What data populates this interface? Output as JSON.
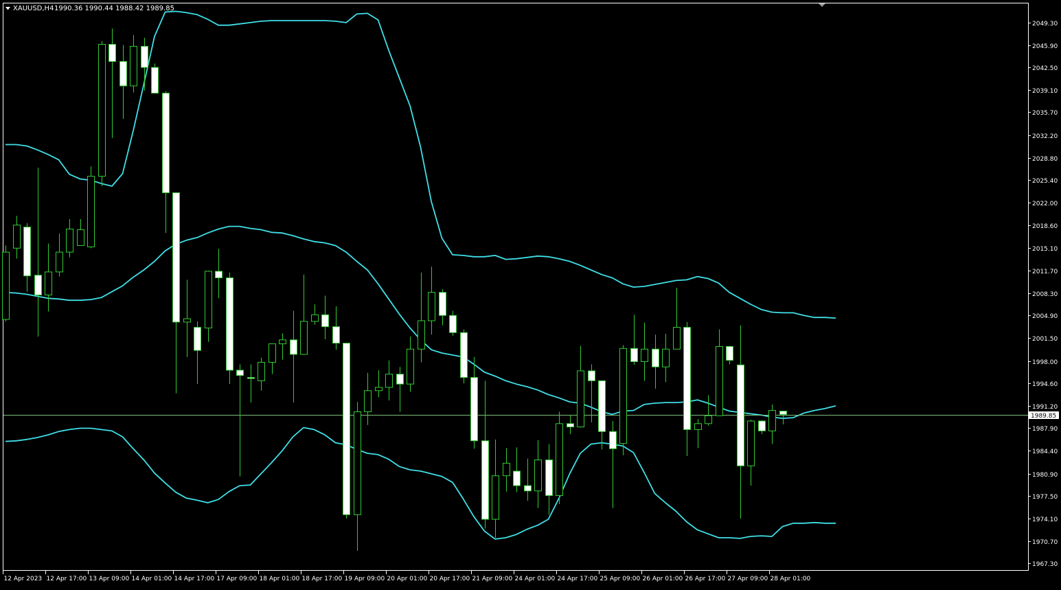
{
  "header": {
    "symbol": "XAUUSD,H4",
    "ohlc": "1990.36 1990.44 1988.42 1989.85"
  },
  "colors": {
    "background": "#000000",
    "frame": "#ffffff",
    "bull_body": "#000000",
    "bear_body": "#ffffff",
    "wick": "#33cc33",
    "bands": "#40e0e8",
    "bid_line": "#7fbf7f",
    "current_price_bg": "#ffffff",
    "current_price_text": "#000000"
  },
  "current_price": {
    "value": 1989.85,
    "label": "1989.85"
  },
  "chart_data": {
    "type": "candlestick",
    "symbol": "XAUUSD",
    "timeframe": "H4",
    "grid": false,
    "ylim": [
      1966.3,
      2052.2
    ],
    "y_ticks": [
      {
        "value": 2049.3,
        "label": "2049.30"
      },
      {
        "value": 2045.9,
        "label": "2045.90"
      },
      {
        "value": 2042.5,
        "label": "2042.50"
      },
      {
        "value": 2039.1,
        "label": "2039.10"
      },
      {
        "value": 2035.7,
        "label": "2035.70"
      },
      {
        "value": 2032.2,
        "label": "2032.20"
      },
      {
        "value": 2028.8,
        "label": "2028.80"
      },
      {
        "value": 2025.4,
        "label": "2025.40"
      },
      {
        "value": 2022.0,
        "label": "2022.00"
      },
      {
        "value": 2018.6,
        "label": "2018.60"
      },
      {
        "value": 2015.1,
        "label": "2015.10"
      },
      {
        "value": 2011.7,
        "label": "2011.70"
      },
      {
        "value": 2008.3,
        "label": "2008.30"
      },
      {
        "value": 2004.9,
        "label": "2004.90"
      },
      {
        "value": 2001.5,
        "label": "2001.50"
      },
      {
        "value": 1998.0,
        "label": "1998.00"
      },
      {
        "value": 1994.6,
        "label": "1994.60"
      },
      {
        "value": 1991.2,
        "label": "1991.20"
      },
      {
        "value": 1987.9,
        "label": "1987.90"
      },
      {
        "value": 1984.4,
        "label": "1984.40"
      },
      {
        "value": 1980.9,
        "label": "1980.90"
      },
      {
        "value": 1977.5,
        "label": "1977.50"
      },
      {
        "value": 1974.1,
        "label": "1974.10"
      },
      {
        "value": 1970.7,
        "label": "1970.70"
      },
      {
        "value": 1967.3,
        "label": "1967.30"
      }
    ],
    "x_ticks": [
      {
        "index": 0,
        "label": "12 Apr 2023"
      },
      {
        "index": 4,
        "label": "12 Apr 17:00"
      },
      {
        "index": 8,
        "label": "13 Apr 09:00"
      },
      {
        "index": 12,
        "label": "14 Apr 01:00"
      },
      {
        "index": 16,
        "label": "14 Apr 17:00"
      },
      {
        "index": 20,
        "label": "17 Apr 09:00"
      },
      {
        "index": 24,
        "label": "18 Apr 01:00"
      },
      {
        "index": 28,
        "label": "18 Apr 17:00"
      },
      {
        "index": 32,
        "label": "19 Apr 09:00"
      },
      {
        "index": 36,
        "label": "20 Apr 01:00"
      },
      {
        "index": 40,
        "label": "20 Apr 17:00"
      },
      {
        "index": 44,
        "label": "21 Apr 09:00"
      },
      {
        "index": 48,
        "label": "24 Apr 01:00"
      },
      {
        "index": 52,
        "label": "24 Apr 17:00"
      },
      {
        "index": 56,
        "label": "25 Apr 09:00"
      },
      {
        "index": 60,
        "label": "26 Apr 01:00"
      },
      {
        "index": 64,
        "label": "26 Apr 17:00"
      },
      {
        "index": 68,
        "label": "27 Apr 09:00"
      },
      {
        "index": 72,
        "label": "28 Apr 01:00"
      }
    ],
    "candles": [
      {
        "o": 2004.3,
        "h": 2015.5,
        "l": 2004.0,
        "c": 2014.5
      },
      {
        "o": 2015.1,
        "h": 2020.0,
        "l": 2013.5,
        "c": 2018.6
      },
      {
        "o": 2018.3,
        "h": 2018.9,
        "l": 2008.5,
        "c": 2010.9
      },
      {
        "o": 2011.0,
        "h": 2027.3,
        "l": 2001.7,
        "c": 2008.0
      },
      {
        "o": 2008.0,
        "h": 2015.8,
        "l": 2005.5,
        "c": 2011.5
      },
      {
        "o": 2011.5,
        "h": 2017.3,
        "l": 2010.8,
        "c": 2014.5
      },
      {
        "o": 2014.5,
        "h": 2019.5,
        "l": 2013.7,
        "c": 2018.0
      },
      {
        "o": 2015.5,
        "h": 2019.5,
        "l": 2015.5,
        "c": 2017.9
      },
      {
        "o": 2015.3,
        "h": 2027.5,
        "l": 2015.1,
        "c": 2026.0
      },
      {
        "o": 2026.0,
        "h": 2046.5,
        "l": 2024.5,
        "c": 2046.0
      },
      {
        "o": 2046.0,
        "h": 2048.4,
        "l": 2031.8,
        "c": 2043.4
      },
      {
        "o": 2043.4,
        "h": 2045.9,
        "l": 2034.7,
        "c": 2039.7
      },
      {
        "o": 2039.7,
        "h": 2047.4,
        "l": 2038.7,
        "c": 2045.7
      },
      {
        "o": 2045.7,
        "h": 2047.0,
        "l": 2039.0,
        "c": 2042.5
      },
      {
        "o": 2042.5,
        "h": 2043.1,
        "l": 2038.6,
        "c": 2038.6
      },
      {
        "o": 2038.6,
        "h": 2038.9,
        "l": 2017.4,
        "c": 2023.5
      },
      {
        "o": 2023.5,
        "h": 2023.5,
        "l": 1993.1,
        "c": 2003.9
      },
      {
        "o": 2003.9,
        "h": 2010.3,
        "l": 1998.6,
        "c": 2004.4
      },
      {
        "o": 2003.1,
        "h": 2004.0,
        "l": 1994.5,
        "c": 1999.6
      },
      {
        "o": 2003.0,
        "h": 2011.7,
        "l": 2000.9,
        "c": 2011.6
      },
      {
        "o": 2011.6,
        "h": 2015.0,
        "l": 2007.5,
        "c": 2010.6
      },
      {
        "o": 2010.6,
        "h": 2011.4,
        "l": 1994.5,
        "c": 1996.6
      },
      {
        "o": 1996.6,
        "h": 1997.5,
        "l": 1980.5,
        "c": 1995.8
      },
      {
        "o": 1995.5,
        "h": 1997.5,
        "l": 1991.7,
        "c": 1995.4
      },
      {
        "o": 1995.0,
        "h": 1998.5,
        "l": 1993.5,
        "c": 1997.8
      },
      {
        "o": 1997.8,
        "h": 2000.5,
        "l": 1996.0,
        "c": 2000.6
      },
      {
        "o": 2000.6,
        "h": 2002.2,
        "l": 1998.2,
        "c": 2001.2
      },
      {
        "o": 2001.2,
        "h": 2005.6,
        "l": 1991.7,
        "c": 1999.0
      },
      {
        "o": 1999.0,
        "h": 2011.1,
        "l": 1998.9,
        "c": 2004.0
      },
      {
        "o": 2004.0,
        "h": 2006.6,
        "l": 2003.5,
        "c": 2005.0
      },
      {
        "o": 2005.0,
        "h": 2007.9,
        "l": 2001.3,
        "c": 2003.2
      },
      {
        "o": 2003.2,
        "h": 2006.3,
        "l": 1999.7,
        "c": 2000.7
      },
      {
        "o": 2000.7,
        "h": 2000.7,
        "l": 1974.1,
        "c": 1974.7
      },
      {
        "o": 1974.7,
        "h": 1991.8,
        "l": 1969.2,
        "c": 1990.3
      },
      {
        "o": 1990.3,
        "h": 1996.2,
        "l": 1988.3,
        "c": 1993.5
      },
      {
        "o": 1993.5,
        "h": 1996.6,
        "l": 1992.5,
        "c": 1994.0
      },
      {
        "o": 1994.0,
        "h": 1998.1,
        "l": 1992.0,
        "c": 1996.0
      },
      {
        "o": 1996.0,
        "h": 1997.1,
        "l": 1990.3,
        "c": 1994.5
      },
      {
        "o": 1994.5,
        "h": 2001.7,
        "l": 1993.3,
        "c": 1999.8
      },
      {
        "o": 1999.8,
        "h": 2011.4,
        "l": 1997.8,
        "c": 2004.1
      },
      {
        "o": 2004.1,
        "h": 2012.3,
        "l": 2002.0,
        "c": 2008.4
      },
      {
        "o": 2008.4,
        "h": 2008.9,
        "l": 2003.4,
        "c": 2004.9
      },
      {
        "o": 2004.9,
        "h": 2005.6,
        "l": 2001.8,
        "c": 2002.3
      },
      {
        "o": 2002.3,
        "h": 2002.8,
        "l": 1994.6,
        "c": 1995.5
      },
      {
        "o": 1995.5,
        "h": 1998.6,
        "l": 1984.7,
        "c": 1985.9
      },
      {
        "o": 1985.9,
        "h": 1995.0,
        "l": 1972.6,
        "c": 1974.0
      },
      {
        "o": 1974.0,
        "h": 1986.1,
        "l": 1971.2,
        "c": 1980.6
      },
      {
        "o": 1980.6,
        "h": 1984.8,
        "l": 1978.2,
        "c": 1982.5
      },
      {
        "o": 1981.3,
        "h": 1984.9,
        "l": 1978.1,
        "c": 1979.1
      },
      {
        "o": 1979.1,
        "h": 1983.2,
        "l": 1976.8,
        "c": 1978.3
      },
      {
        "o": 1978.3,
        "h": 1986.0,
        "l": 1975.7,
        "c": 1983.0
      },
      {
        "o": 1983.0,
        "h": 1985.4,
        "l": 1974.7,
        "c": 1977.6
      },
      {
        "o": 1977.6,
        "h": 1990.3,
        "l": 1976.3,
        "c": 1988.5
      },
      {
        "o": 1988.5,
        "h": 1989.8,
        "l": 1986.9,
        "c": 1988.0
      },
      {
        "o": 1988.0,
        "h": 2000.3,
        "l": 1987.9,
        "c": 1996.5
      },
      {
        "o": 1996.5,
        "h": 1997.5,
        "l": 1988.7,
        "c": 1995.0
      },
      {
        "o": 1995.0,
        "h": 1995.0,
        "l": 1984.6,
        "c": 1987.3
      },
      {
        "o": 1987.3,
        "h": 1988.9,
        "l": 1975.7,
        "c": 1984.7
      },
      {
        "o": 1985.5,
        "h": 2000.4,
        "l": 1983.7,
        "c": 1999.9
      },
      {
        "o": 1999.9,
        "h": 2005.0,
        "l": 1997.4,
        "c": 1997.9
      },
      {
        "o": 1997.9,
        "h": 2003.8,
        "l": 1995.0,
        "c": 1999.8
      },
      {
        "o": 1999.8,
        "h": 2002.0,
        "l": 1993.8,
        "c": 1997.1
      },
      {
        "o": 1997.1,
        "h": 2002.1,
        "l": 1994.8,
        "c": 1999.8
      },
      {
        "o": 1999.8,
        "h": 2009.1,
        "l": 1999.8,
        "c": 2003.1
      },
      {
        "o": 2003.1,
        "h": 2003.9,
        "l": 1983.6,
        "c": 1987.6
      },
      {
        "o": 1987.6,
        "h": 1989.2,
        "l": 1984.8,
        "c": 1988.5
      },
      {
        "o": 1988.5,
        "h": 1992.8,
        "l": 1988.2,
        "c": 1989.7
      },
      {
        "o": 1989.7,
        "h": 2002.8,
        "l": 1990.3,
        "c": 2000.2
      },
      {
        "o": 2000.2,
        "h": 2000.3,
        "l": 1997.5,
        "c": 1998.1
      },
      {
        "o": 1997.4,
        "h": 2003.4,
        "l": 1974.1,
        "c": 1982.1
      },
      {
        "o": 1982.1,
        "h": 1989.1,
        "l": 1979.1,
        "c": 1988.9
      },
      {
        "o": 1988.9,
        "h": 1989.0,
        "l": 1986.9,
        "c": 1987.4
      },
      {
        "o": 1987.4,
        "h": 1991.4,
        "l": 1985.4,
        "c": 1990.5
      },
      {
        "o": 1990.4,
        "h": 1990.4,
        "l": 1988.4,
        "c": 1989.9
      }
    ],
    "series": [
      {
        "name": "Upper band",
        "values": [
          2030.8,
          2030.8,
          2030.6,
          2030.0,
          2029.3,
          2028.5,
          2026.3,
          2025.6,
          2025.4,
          2024.9,
          2024.5,
          2026.4,
          2032.9,
          2040.0,
          2047.2,
          2050.9,
          2051.0,
          2050.8,
          2050.5,
          2049.8,
          2048.9,
          2048.9,
          2049.1,
          2049.3,
          2049.5,
          2049.6,
          2049.6,
          2049.6,
          2049.6,
          2049.6,
          2049.6,
          2049.5,
          2049.3,
          2050.6,
          2050.7,
          2049.7,
          2045.1,
          2040.9,
          2036.7,
          2030.4,
          2022.2,
          2016.6,
          2014.1,
          2014.0,
          2013.8,
          2013.8,
          2014.0,
          2013.4,
          2013.5,
          2013.7,
          2013.9,
          2013.8,
          2013.5,
          2013.1,
          2012.5,
          2011.8,
          2011.1,
          2010.6,
          2009.7,
          2009.2,
          2009.3,
          2009.6,
          2009.9,
          2010.2,
          2010.3,
          2010.8,
          2010.5,
          2009.8,
          2008.4,
          2007.5,
          2006.6,
          2005.8,
          2005.4,
          2005.3,
          2005.3,
          2004.9,
          2004.6,
          2004.6,
          2004.5
        ]
      },
      {
        "name": "Middle band",
        "values": [
          2008.4,
          2008.3,
          2008.1,
          2007.8,
          2007.5,
          2007.4,
          2007.2,
          2007.2,
          2007.3,
          2007.6,
          2008.5,
          2009.4,
          2010.7,
          2011.8,
          2013.1,
          2014.7,
          2015.7,
          2016.3,
          2016.7,
          2017.4,
          2018.0,
          2018.4,
          2018.4,
          2018.1,
          2017.9,
          2017.5,
          2017.4,
          2017.0,
          2016.5,
          2016.1,
          2015.9,
          2015.5,
          2014.5,
          2013.1,
          2011.8,
          2009.7,
          2007.4,
          2005.1,
          2003.0,
          2001.2,
          1999.7,
          1999.2,
          1998.9,
          1998.6,
          1997.5,
          1996.3,
          1995.7,
          1995.0,
          1994.5,
          1994.1,
          1993.6,
          1992.9,
          1992.4,
          1991.8,
          1991.6,
          1991.0,
          1990.3,
          1989.9,
          1990.4,
          1990.5,
          1991.4,
          1991.6,
          1991.7,
          1991.7,
          1991.8,
          1992.1,
          1991.6,
          1991.0,
          1990.4,
          1990.2,
          1990.0,
          1989.8,
          1989.5,
          1989.3,
          1989.4,
          1990.1,
          1990.5,
          1990.8,
          1991.2
        ]
      },
      {
        "name": "Lower band",
        "values": [
          1985.8,
          1985.9,
          1986.1,
          1986.4,
          1986.8,
          1987.3,
          1987.6,
          1987.8,
          1987.8,
          1987.6,
          1987.4,
          1986.5,
          1984.7,
          1983.0,
          1981.0,
          1979.5,
          1978.1,
          1977.2,
          1976.9,
          1976.5,
          1977.0,
          1978.2,
          1979.1,
          1979.2,
          1980.9,
          1982.6,
          1984.4,
          1986.5,
          1987.9,
          1987.6,
          1986.8,
          1985.6,
          1985.3,
          1984.6,
          1984.0,
          1983.8,
          1983.1,
          1982.0,
          1981.5,
          1981.3,
          1980.9,
          1980.5,
          1979.6,
          1977.1,
          1974.4,
          1972.2,
          1971.0,
          1971.2,
          1971.7,
          1972.5,
          1973.1,
          1974.0,
          1977.2,
          1980.9,
          1984.0,
          1985.4,
          1985.6,
          1985.4,
          1985.1,
          1984.1,
          1981.1,
          1977.9,
          1976.5,
          1975.2,
          1973.6,
          1972.4,
          1971.8,
          1971.2,
          1971.2,
          1971.1,
          1971.4,
          1971.5,
          1971.4,
          1972.9,
          1973.4,
          1973.4,
          1973.5,
          1973.4,
          1973.4
        ]
      }
    ]
  }
}
